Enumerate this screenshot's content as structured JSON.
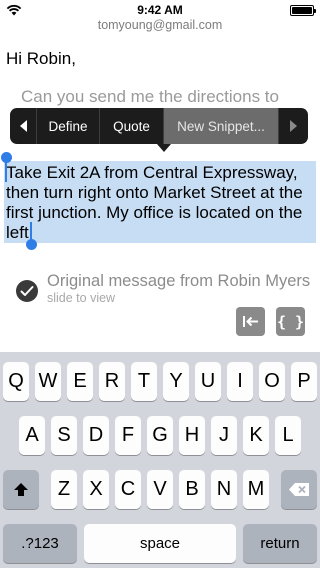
{
  "status_bar": {
    "time": "9:42 AM"
  },
  "header": {
    "from_email": "tomyoung@gmail.com"
  },
  "message": {
    "greeting": "Hi Robin,",
    "faded_line": "Can you send me the directions to",
    "selected_lines": [
      "Take Exit 2A from Central Expressway,",
      "then turn right onto Market Street at the",
      "first junction. My office is located on the",
      "left."
    ]
  },
  "edit_menu": {
    "define_label": "Define",
    "quote_label": "Quote",
    "snippet_label": "New Snippet..."
  },
  "original_message": {
    "title": "Original message from Robin Myers",
    "subtitle": "slide to view"
  },
  "tools": {
    "brace_label": "{ }"
  },
  "keyboard": {
    "row1": [
      "Q",
      "W",
      "E",
      "R",
      "T",
      "Y",
      "U",
      "I",
      "O",
      "P"
    ],
    "row2": [
      "A",
      "S",
      "D",
      "F",
      "G",
      "H",
      "J",
      "K",
      "L"
    ],
    "row3": [
      "Z",
      "X",
      "C",
      "V",
      "B",
      "N",
      "M"
    ],
    "numbers_label": ".?123",
    "space_label": "space",
    "return_label": "return"
  },
  "colors": {
    "selection": "#c7ddf3",
    "handle": "#2f7ee8",
    "keyboard_bg": "#d2d5db"
  }
}
